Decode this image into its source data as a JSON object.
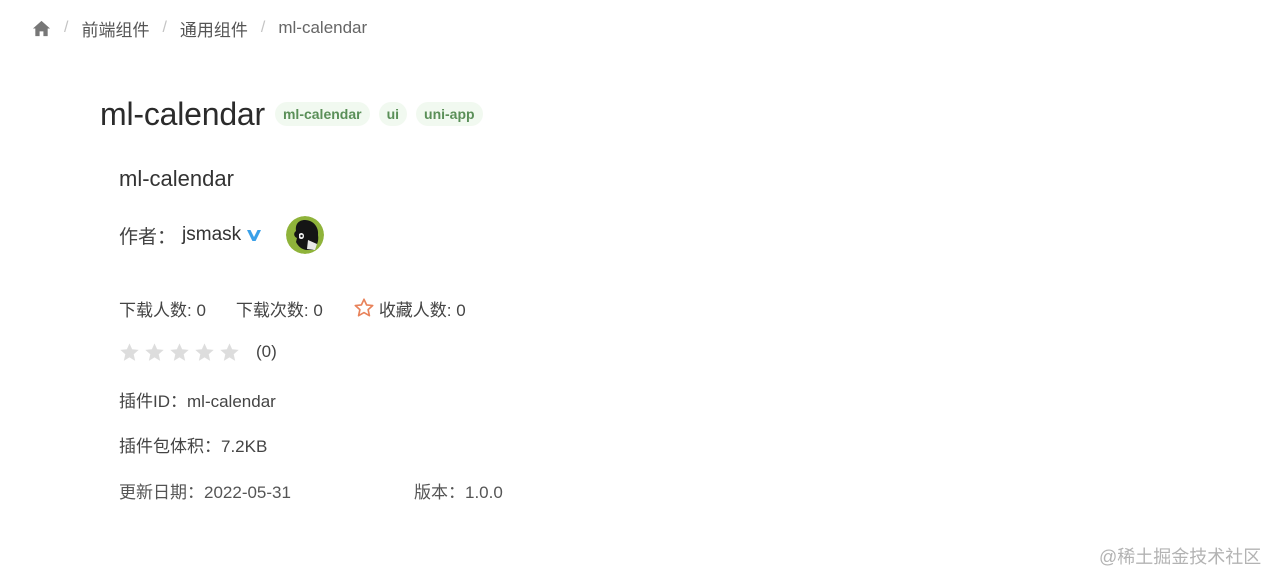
{
  "breadcrumb": {
    "home_icon": "home-icon",
    "separator": "/",
    "items": [
      "前端组件",
      "通用组件",
      "ml-calendar"
    ]
  },
  "plugin": {
    "title": "ml-calendar",
    "tags": [
      "ml-calendar",
      "ui",
      "uni-app"
    ],
    "subtitle": "ml-calendar"
  },
  "author": {
    "label": "作者：",
    "name": "jsmask",
    "verified_icon": "verified-v-icon",
    "avatar": "avatar"
  },
  "stats": {
    "downloaders": "下载人数: 0",
    "downloads": "下载次数: 0",
    "favorites": "收藏人数: 0",
    "favorite_icon": "star-outline-icon"
  },
  "rating": {
    "value": 0,
    "max": 5,
    "count": "(0)"
  },
  "info": {
    "plugin_id": "插件ID：ml-calendar",
    "size": "插件包体积：7.2KB",
    "updated": "更新日期：2022-05-31",
    "version": "版本：1.0.0"
  },
  "watermark": "@稀土掘金技术社区",
  "colors": {
    "tag_bg": "#f1f9f0",
    "tag_text": "#5a8f58",
    "verified": "#3aa0e8",
    "favorite_star": "#e8825a",
    "rating_star_empty": "#dddddd"
  }
}
